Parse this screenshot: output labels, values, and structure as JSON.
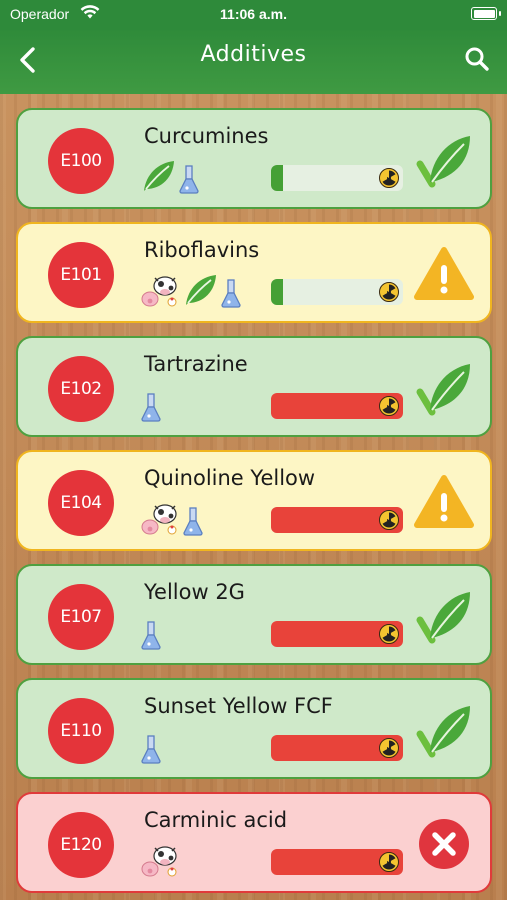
{
  "status": {
    "carrier": "Operador",
    "time": "11:06 a.m."
  },
  "nav": {
    "title": "Additives"
  },
  "colors": {
    "green": "#4fa040",
    "warn": "#f0b51f",
    "bad": "#e03a3a",
    "badge": "#e4343a",
    "bar_high": "#e8433a",
    "bar_low": "#45a035"
  },
  "items": [
    {
      "code": "E100",
      "name": "Curcumines",
      "icons": [
        "leaf-icon",
        "flask-icon"
      ],
      "level": 0.06,
      "verdict": "check-leaf-icon",
      "status": "safe"
    },
    {
      "code": "E101",
      "name": "Riboflavins",
      "icons": [
        "animal-icon",
        "leaf-icon",
        "flask-icon"
      ],
      "level": 0.06,
      "verdict": "warning-icon",
      "status": "caution"
    },
    {
      "code": "E102",
      "name": "Tartrazine",
      "icons": [
        "flask-icon"
      ],
      "level": 1.0,
      "verdict": "check-leaf-icon",
      "status": "safe"
    },
    {
      "code": "E104",
      "name": "Quinoline Yellow",
      "icons": [
        "animal-icon",
        "flask-icon"
      ],
      "level": 1.0,
      "verdict": "warning-icon",
      "status": "caution"
    },
    {
      "code": "E107",
      "name": "Yellow 2G",
      "icons": [
        "flask-icon"
      ],
      "level": 1.0,
      "verdict": "check-leaf-icon",
      "status": "safe"
    },
    {
      "code": "E110",
      "name": "Sunset Yellow FCF",
      "icons": [
        "flask-icon"
      ],
      "level": 1.0,
      "verdict": "check-leaf-icon",
      "status": "safe"
    },
    {
      "code": "E120",
      "name": "Carminic acid",
      "icons": [
        "animal-icon"
      ],
      "level": 1.0,
      "verdict": "cross-icon",
      "status": "avoid"
    }
  ]
}
